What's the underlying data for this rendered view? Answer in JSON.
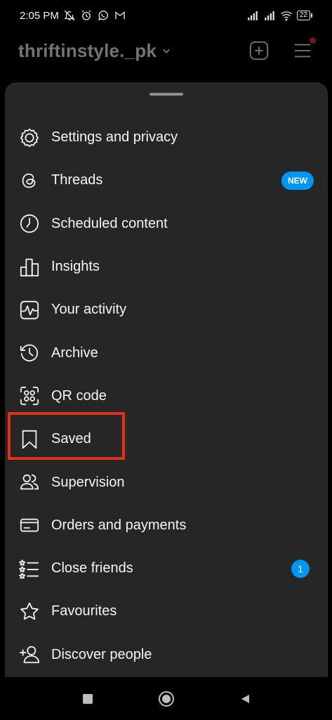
{
  "status_bar": {
    "time": "2:05 PM",
    "battery": "22",
    "icons": [
      "mute-icon",
      "alarm-icon",
      "whatsapp-icon",
      "gmail-icon",
      "signal-icon",
      "signal-icon",
      "wifi-icon",
      "battery-icon"
    ]
  },
  "header": {
    "username": "thriftinstyle._pk",
    "icons": [
      "chevron-down-icon",
      "new-post-icon",
      "menu-icon"
    ]
  },
  "menu": {
    "items": [
      {
        "label": "Settings and privacy",
        "icon": "settings-icon"
      },
      {
        "label": "Threads",
        "icon": "threads-icon",
        "badge": "NEW"
      },
      {
        "label": "Scheduled content",
        "icon": "clock-icon"
      },
      {
        "label": "Insights",
        "icon": "insights-icon"
      },
      {
        "label": "Your activity",
        "icon": "activity-icon"
      },
      {
        "label": "Archive",
        "icon": "archive-icon"
      },
      {
        "label": "QR code",
        "icon": "qr-code-icon"
      },
      {
        "label": "Saved",
        "icon": "bookmark-icon",
        "highlighted": true
      },
      {
        "label": "Supervision",
        "icon": "supervision-icon"
      },
      {
        "label": "Orders and payments",
        "icon": "card-icon"
      },
      {
        "label": "Close friends",
        "icon": "close-friends-icon",
        "badge": "1"
      },
      {
        "label": "Favourites",
        "icon": "star-icon"
      },
      {
        "label": "Discover people",
        "icon": "add-person-icon"
      }
    ]
  },
  "colors": {
    "accent": "#0095f6",
    "highlight": "#e0301e",
    "sheet_background": "#262626",
    "notification": "#ff3040"
  },
  "navbar": {
    "icons": [
      "recents-icon",
      "home-icon",
      "back-icon"
    ]
  }
}
